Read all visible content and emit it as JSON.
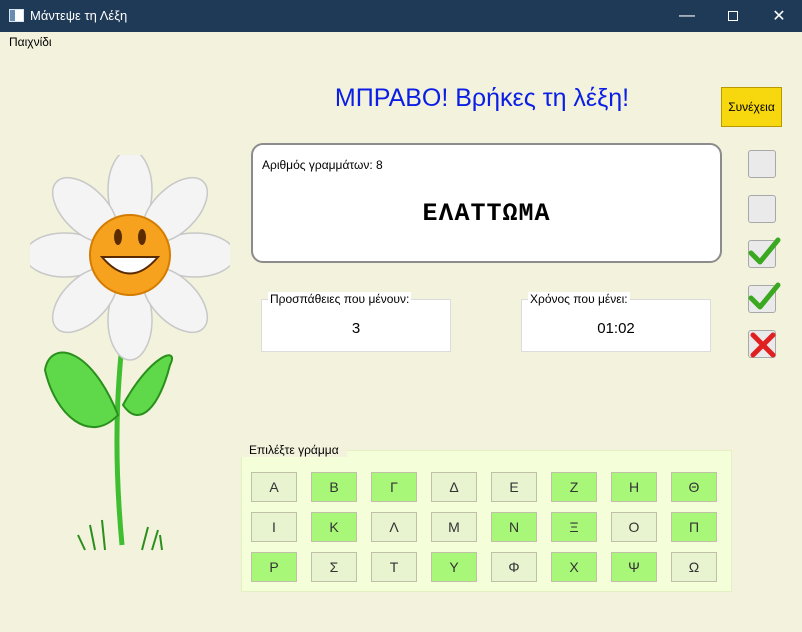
{
  "window": {
    "title": "Μάντεψε τη Λέξη",
    "minimize": "—",
    "close": "✕"
  },
  "menu": {
    "items": [
      "Παιχνίδι"
    ]
  },
  "message": "ΜΠΡΑΒΟ! Βρήκες τη λέξη!",
  "continue_label": "Συνέχεια",
  "word_panel": {
    "letters_count_label": "Αριθμός γραμμάτων: 8",
    "word": "ΕΛΑΤΤΩΜΑ"
  },
  "attempts": {
    "label": "Προσπάθειες που μένουν:",
    "value": "3"
  },
  "timer": {
    "label": "Χρόνος που μένει:",
    "value": "01:02"
  },
  "status_boxes": [
    "empty",
    "empty",
    "check",
    "check",
    "cross"
  ],
  "colors": {
    "message": "#0a1ee6",
    "continue_bg": "#f7d70e",
    "used_letter": "#a9f779",
    "unused_letter": "#e8f4cf",
    "titlebar": "#1f3a57",
    "background": "#f3f2dc"
  },
  "letters": {
    "legend": "Επιλέξτε γράμμα",
    "rows": [
      [
        {
          "l": "Α",
          "u": false
        },
        {
          "l": "Β",
          "u": true
        },
        {
          "l": "Γ",
          "u": true
        },
        {
          "l": "Δ",
          "u": false
        },
        {
          "l": "Ε",
          "u": false
        },
        {
          "l": "Ζ",
          "u": true
        },
        {
          "l": "Η",
          "u": true
        },
        {
          "l": "Θ",
          "u": true
        }
      ],
      [
        {
          "l": "Ι",
          "u": false
        },
        {
          "l": "Κ",
          "u": true
        },
        {
          "l": "Λ",
          "u": false
        },
        {
          "l": "Μ",
          "u": false
        },
        {
          "l": "Ν",
          "u": true
        },
        {
          "l": "Ξ",
          "u": true
        },
        {
          "l": "Ο",
          "u": false
        },
        {
          "l": "Π",
          "u": true
        }
      ],
      [
        {
          "l": "Ρ",
          "u": true
        },
        {
          "l": "Σ",
          "u": false
        },
        {
          "l": "Τ",
          "u": false
        },
        {
          "l": "Υ",
          "u": true
        },
        {
          "l": "Φ",
          "u": false
        },
        {
          "l": "Χ",
          "u": true
        },
        {
          "l": "Ψ",
          "u": true
        },
        {
          "l": "Ω",
          "u": false
        }
      ]
    ]
  }
}
